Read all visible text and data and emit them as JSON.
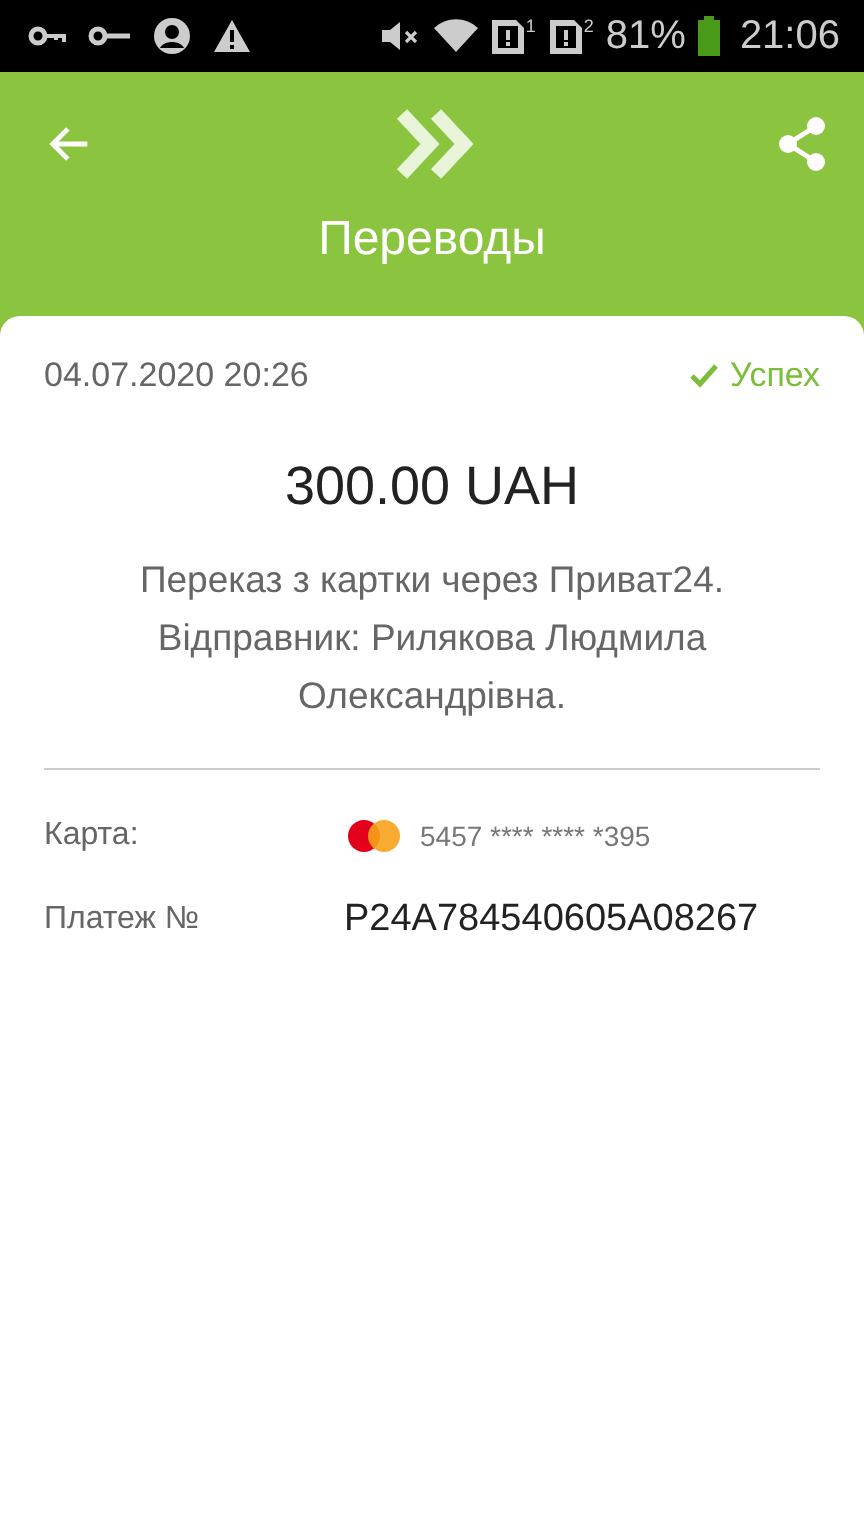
{
  "status_bar": {
    "sims": [
      "1",
      "2"
    ],
    "battery": "81%",
    "time": "21:06"
  },
  "header": {
    "title": "Переводы"
  },
  "receipt": {
    "datetime": "04.07.2020 20:26",
    "status": {
      "label": "Успех",
      "kind": "success"
    },
    "amount": "300.00 UAH",
    "description": "Переказ з картки через Приват24. Відправник: Рилякова Людмила Олександрівна.",
    "rows": [
      {
        "kind": "card",
        "label": "Карта:",
        "value": "5457 **** **** *395"
      },
      {
        "kind": "plain",
        "label": "Платеж №",
        "value": "P24A784540605A08267"
      }
    ]
  }
}
